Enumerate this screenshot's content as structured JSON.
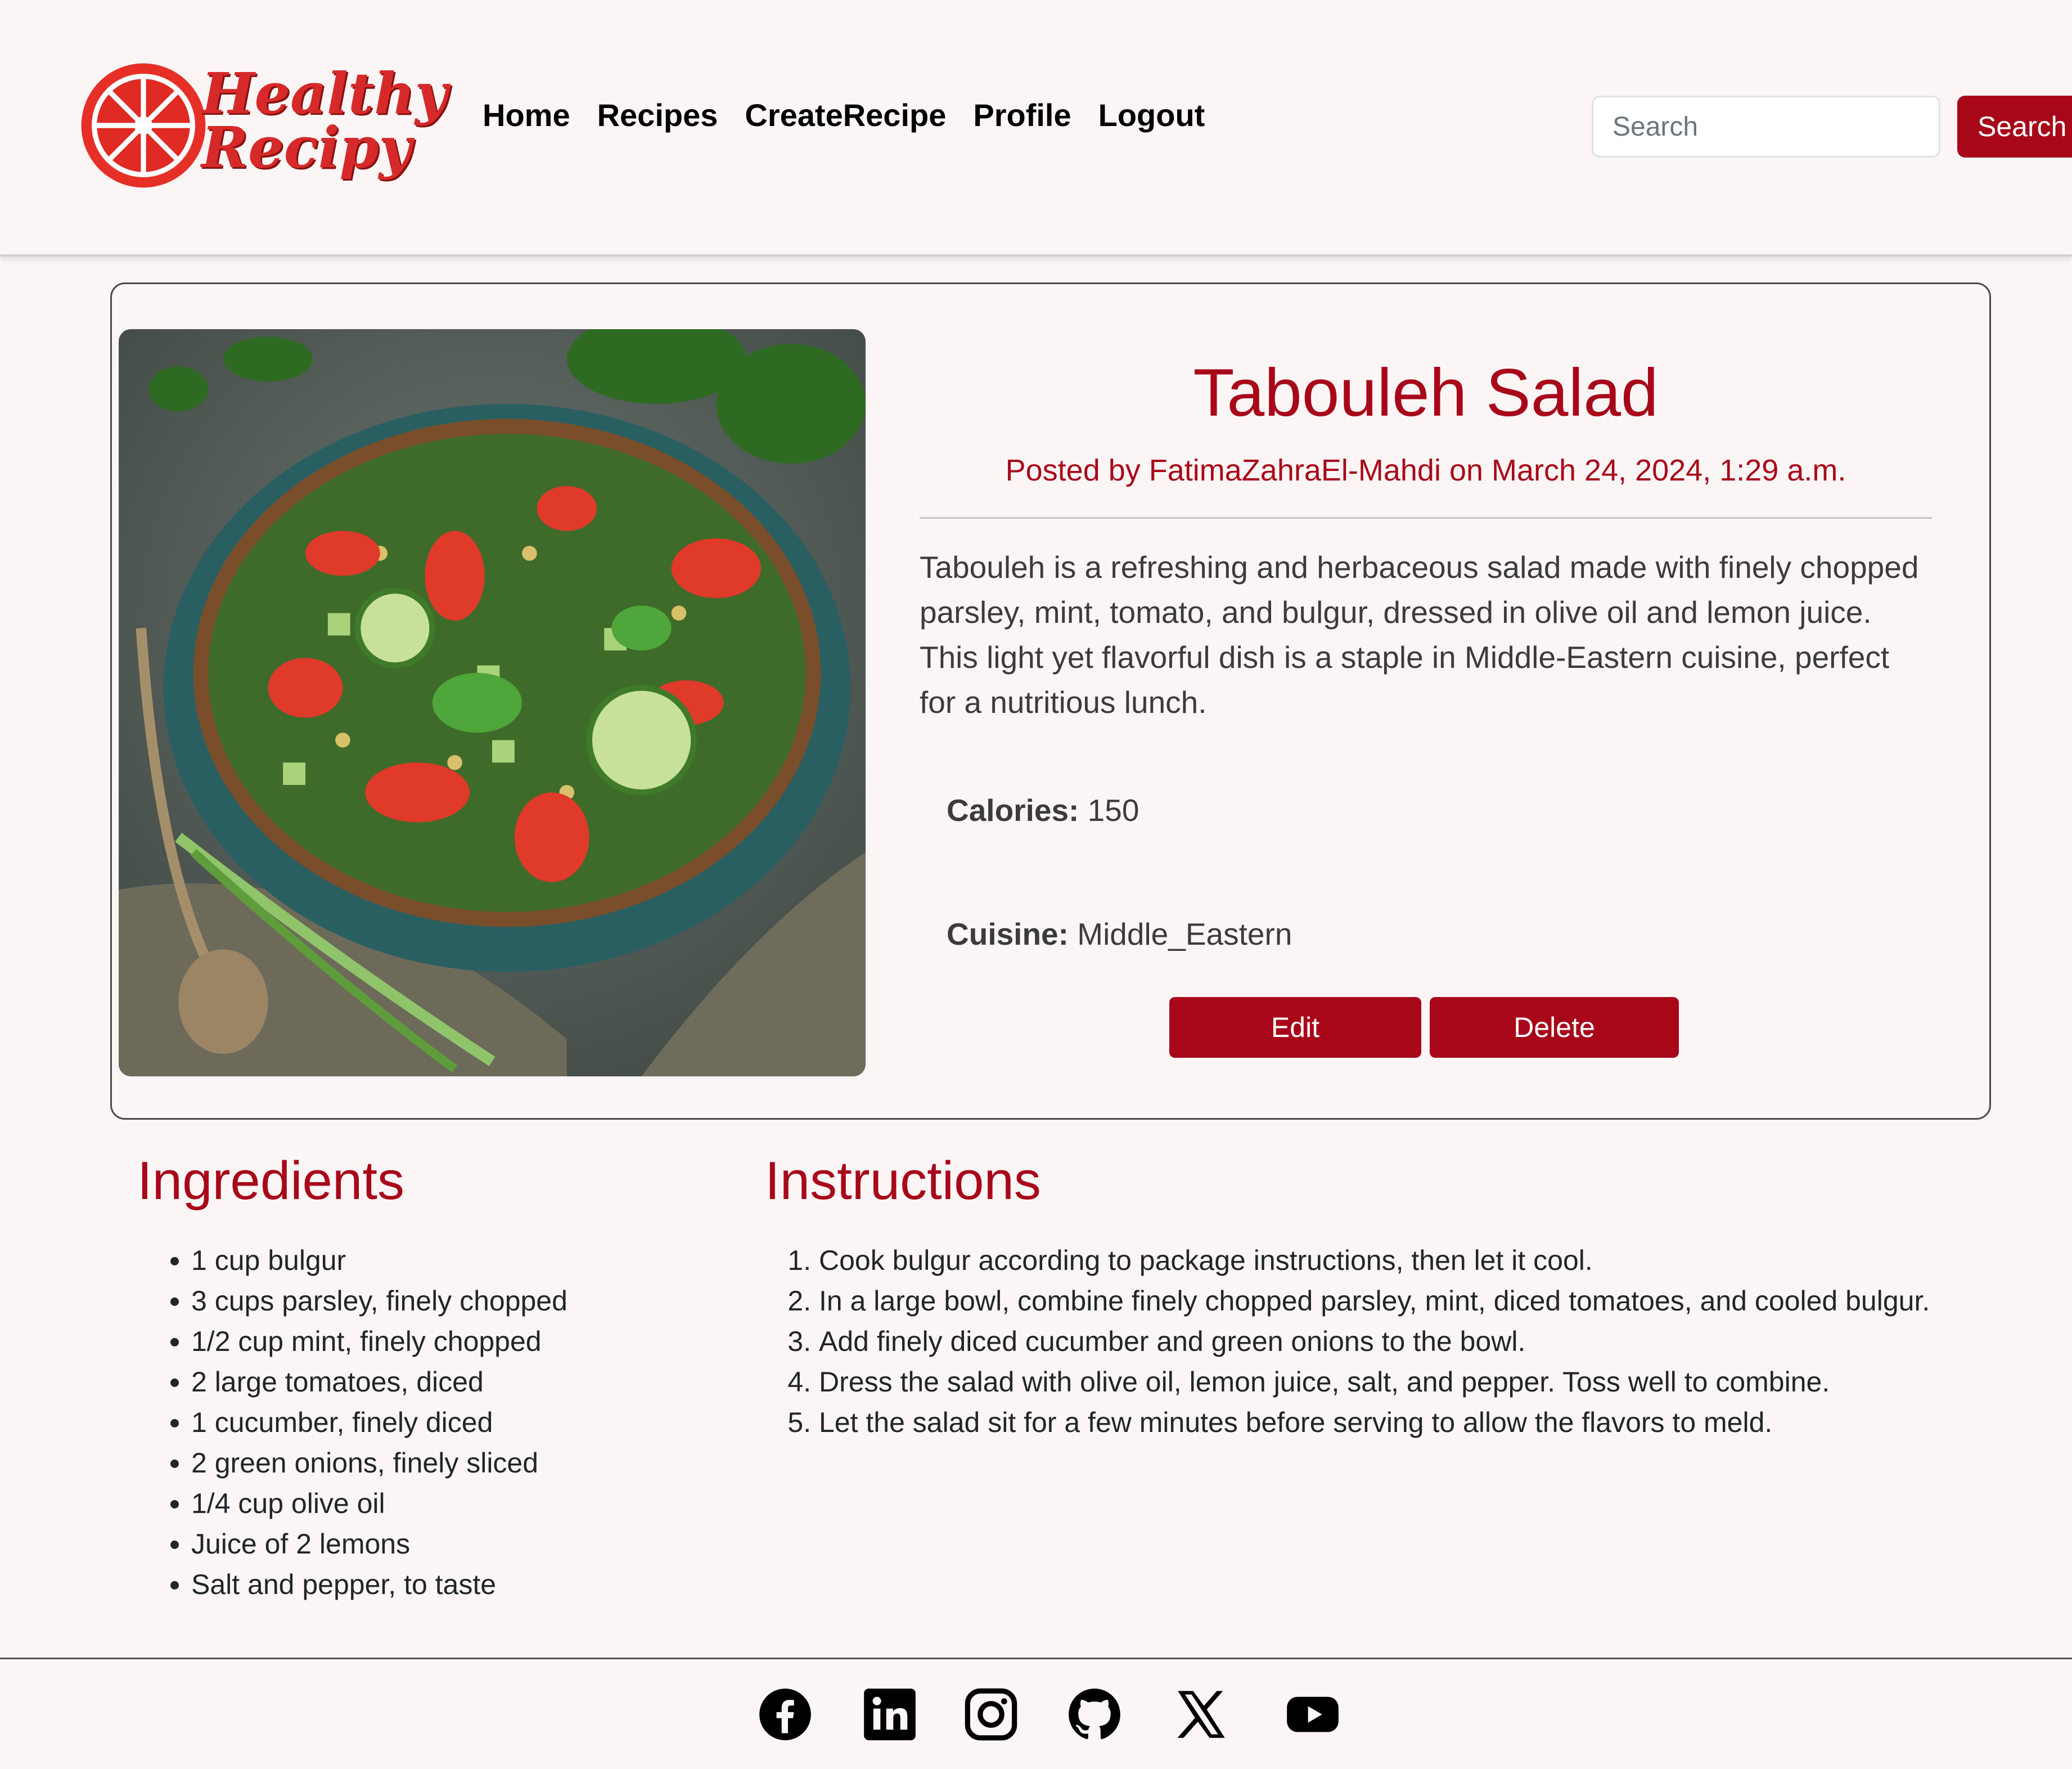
{
  "brand": {
    "logo_line1": "Healthy",
    "logo_line2": "Recipy",
    "accent_color": "#a8071a",
    "logo_color": "#d62a2a"
  },
  "nav": {
    "items": [
      {
        "label": "Home"
      },
      {
        "label": "Recipes"
      },
      {
        "label": "CreateRecipe"
      },
      {
        "label": "Profile"
      },
      {
        "label": "Logout"
      }
    ]
  },
  "search": {
    "placeholder": "Search",
    "value": "",
    "button_label": "Search"
  },
  "recipe": {
    "image_alt_icon": "tabouleh-salad-photo",
    "title": "Tabouleh Salad",
    "meta": "Posted by FatimaZahraEl-Mahdi on March 24, 2024, 1:29 a.m.",
    "description": "Tabouleh is a refreshing and herbaceous salad made with finely chopped parsley, mint, tomato, and bulgur, dressed in olive oil and lemon juice. This light yet flavorful dish is a staple in Middle-Eastern cuisine, perfect for a nutritious lunch.",
    "calories_label": "Calories:",
    "calories_value": "150",
    "cuisine_label": "Cuisine:",
    "cuisine_value": "Middle_Eastern",
    "edit_label": "Edit",
    "delete_label": "Delete"
  },
  "ingredients": {
    "heading": "Ingredients",
    "items": [
      "1 cup bulgur",
      "3 cups parsley, finely chopped",
      "1/2 cup mint, finely chopped",
      "2 large tomatoes, diced",
      "1 cucumber, finely diced",
      "2 green onions, finely sliced",
      "1/4 cup olive oil",
      "Juice of 2 lemons",
      "Salt and pepper, to taste"
    ]
  },
  "instructions": {
    "heading": "Instructions",
    "steps": [
      "Cook bulgur according to package instructions, then let it cool.",
      "In a large bowl, combine finely chopped parsley, mint, diced tomatoes, and cooled bulgur.",
      "Add finely diced cucumber and green onions to the bowl.",
      "Dress the salad with olive oil, lemon juice, salt, and pepper. Toss well to combine.",
      "Let the salad sit for a few minutes before serving to allow the flavors to meld."
    ]
  },
  "footer": {
    "icons": [
      "facebook-icon",
      "linkedin-icon",
      "instagram-icon",
      "github-icon",
      "x-icon",
      "youtube-icon"
    ]
  }
}
